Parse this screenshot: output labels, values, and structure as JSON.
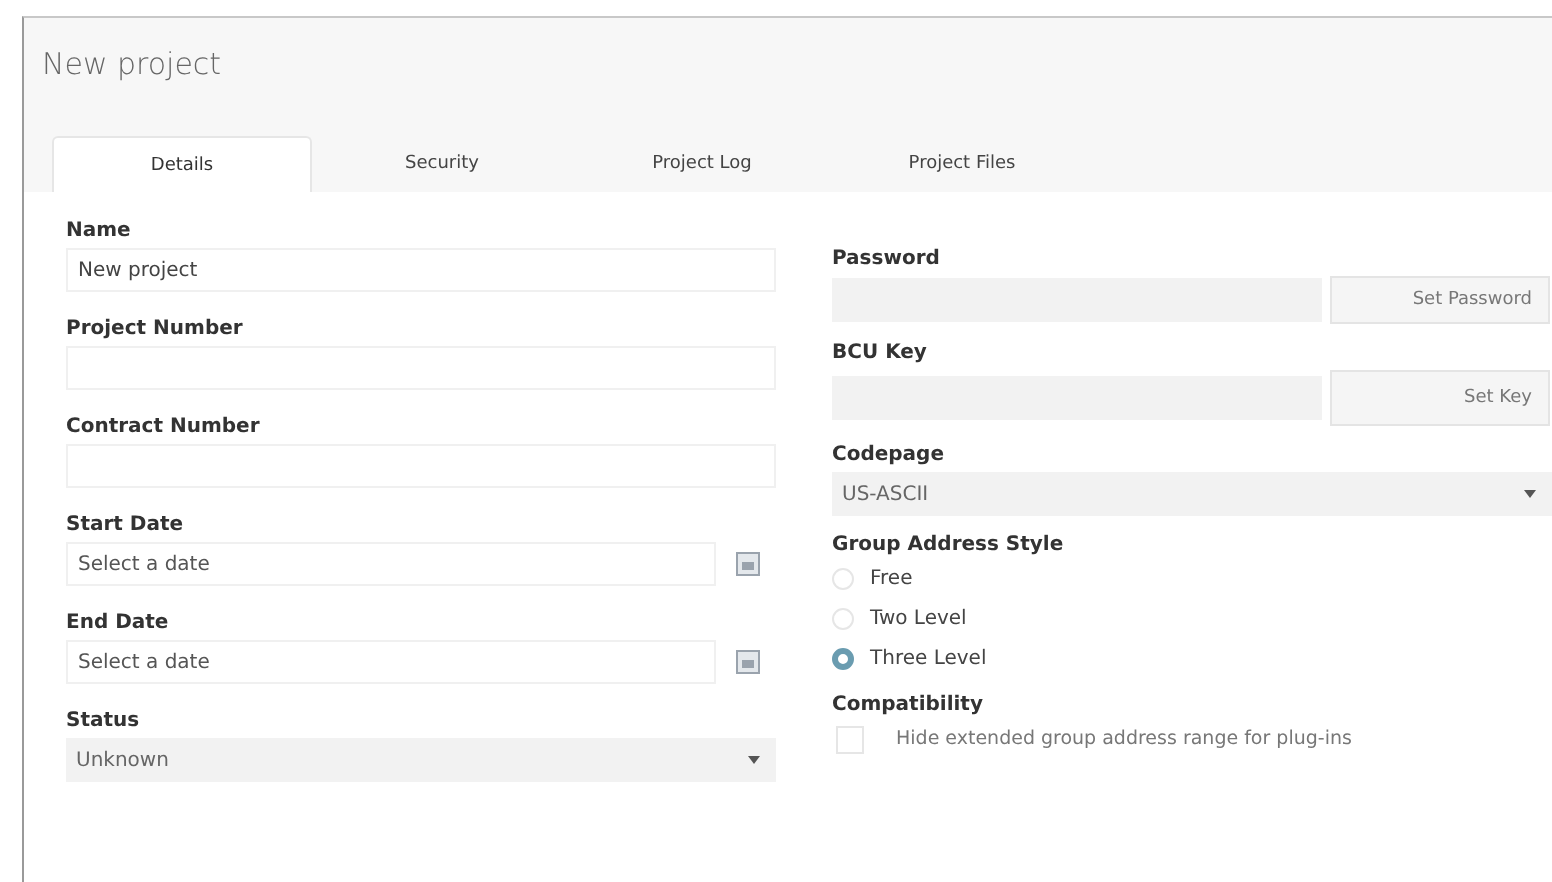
{
  "window": {
    "title": "New project"
  },
  "tabs": [
    {
      "label": "Details",
      "selected": true
    },
    {
      "label": "Security",
      "selected": false
    },
    {
      "label": "Project Log",
      "selected": false
    },
    {
      "label": "Project Files",
      "selected": false
    }
  ],
  "left_fields": [
    {
      "label": "Name",
      "kind": "text",
      "value": "New project"
    },
    {
      "label": "Project Number",
      "kind": "text"
    },
    {
      "label": "Contract Number",
      "kind": "text"
    },
    {
      "label": "Start Date",
      "kind": "date",
      "placeholder": "Select a date"
    },
    {
      "label": "End Date",
      "kind": "date",
      "placeholder": "Select a date"
    },
    {
      "label": "Status",
      "kind": "select",
      "value": "Unknown"
    }
  ],
  "password": {
    "label": "Password",
    "button": "Set Password"
  },
  "bcu_key": {
    "label": "BCU Key",
    "button": "Set Key"
  },
  "codepage": {
    "label": "Codepage",
    "value": "US-ASCII"
  },
  "group_address_style": {
    "label": "Group Address Style",
    "options": [
      {
        "label": "Free",
        "selected": false
      },
      {
        "label": "Two Level",
        "selected": false
      },
      {
        "label": "Three Level",
        "selected": true
      }
    ]
  },
  "compatibility": {
    "label": "Compatibility",
    "option": {
      "label": "Hide extended group address range for plug-ins",
      "checked": false
    }
  }
}
